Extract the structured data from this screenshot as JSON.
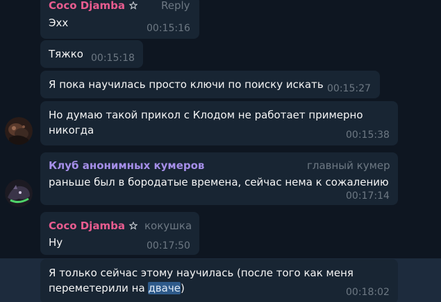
{
  "colors": {
    "background": "#0e1621",
    "bubble": "#182533",
    "selected_row": "#1d2b3d",
    "sender_pink": "#e85c8f",
    "sender_purple": "#a58ee8",
    "meta": "#6d7883"
  },
  "messages": [
    {
      "sender": "Coco Djamba",
      "badge_icon": "star-icon",
      "rank": "Reply",
      "text": "Эхх",
      "time": "00:15:16"
    },
    {
      "text": "Тяжко",
      "time": "00:15:18"
    },
    {
      "text": "Я пока научилась просто ключи по поиску искать",
      "time": "00:15:27"
    },
    {
      "avatar": "user-avatar-dark",
      "line1": "Но думаю такой прикол с Клодом не работает примерно",
      "line2": "никогда",
      "time": "00:15:38"
    },
    {
      "avatar": "user-avatar-green",
      "sender": "Клуб анонимных кумеров",
      "rank": "главный кумер",
      "text": "раньше был в бородатые времена, сейчас нема к сожалению",
      "time": "00:17:14"
    },
    {
      "sender": "Coco Djamba",
      "badge_icon": "star-icon",
      "rank": "кокушка",
      "text": "Ну",
      "time": "00:17:50"
    },
    {
      "line1": "Я только сейчас этому научилась (после того как меня",
      "line2_prefix": "переметерили на ",
      "line2_highlight": "дваче",
      "line2_suffix": ")",
      "time": "00:18:02"
    }
  ]
}
